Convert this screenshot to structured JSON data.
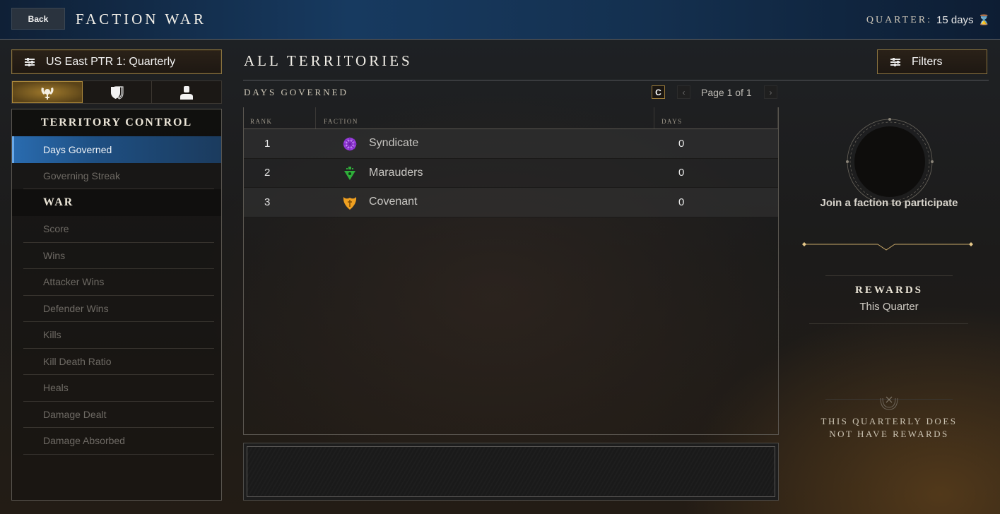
{
  "header": {
    "back_label": "Back",
    "title": "FACTION WAR",
    "quarter_label": "QUARTER:",
    "quarter_value": "15 days",
    "quarter_icon": "hourglass-icon"
  },
  "sidebar": {
    "season_select": "US East PTR 1: Quarterly",
    "tabs": [
      {
        "name": "faction-tab",
        "icon": "faction-crest-icon",
        "active": true
      },
      {
        "name": "company-tab",
        "icon": "shields-icon",
        "active": false
      },
      {
        "name": "player-tab",
        "icon": "person-icon",
        "active": false
      }
    ],
    "sections": [
      {
        "title": "TERRITORY CONTROL",
        "items": [
          {
            "label": "Days Governed",
            "active": true
          },
          {
            "label": "Governing Streak",
            "active": false
          }
        ]
      },
      {
        "title": "WAR",
        "items": [
          {
            "label": "Score"
          },
          {
            "label": "Wins"
          },
          {
            "label": "Attacker Wins"
          },
          {
            "label": "Defender Wins"
          },
          {
            "label": "Kills"
          },
          {
            "label": "Kill Death Ratio"
          },
          {
            "label": "Heals"
          },
          {
            "label": "Damage Dealt"
          },
          {
            "label": "Damage Absorbed"
          }
        ]
      }
    ]
  },
  "main": {
    "title": "ALL TERRITORIES",
    "filters_label": "Filters",
    "subtitle": "DAYS GOVERNED",
    "refresh_label": "C",
    "pagination": {
      "text": "Page 1 of 1",
      "prev": "‹",
      "next": "›"
    },
    "columns": {
      "rank": "RANK",
      "faction": "FACTION",
      "days": "DAYS"
    },
    "rows": [
      {
        "rank": "1",
        "faction": "Syndicate",
        "days": "0",
        "color": "#9b3fe0"
      },
      {
        "rank": "2",
        "faction": "Marauders",
        "days": "0",
        "color": "#2fae3a"
      },
      {
        "rank": "3",
        "faction": "Covenant",
        "days": "0",
        "color": "#f0a020"
      }
    ]
  },
  "right": {
    "join_text": "Join a faction to participate",
    "rewards_title": "REWARDS",
    "rewards_sub": "This Quarter",
    "no_rewards_line1": "THIS QUARTERLY DOES",
    "no_rewards_line2": "NOT HAVE REWARDS"
  }
}
